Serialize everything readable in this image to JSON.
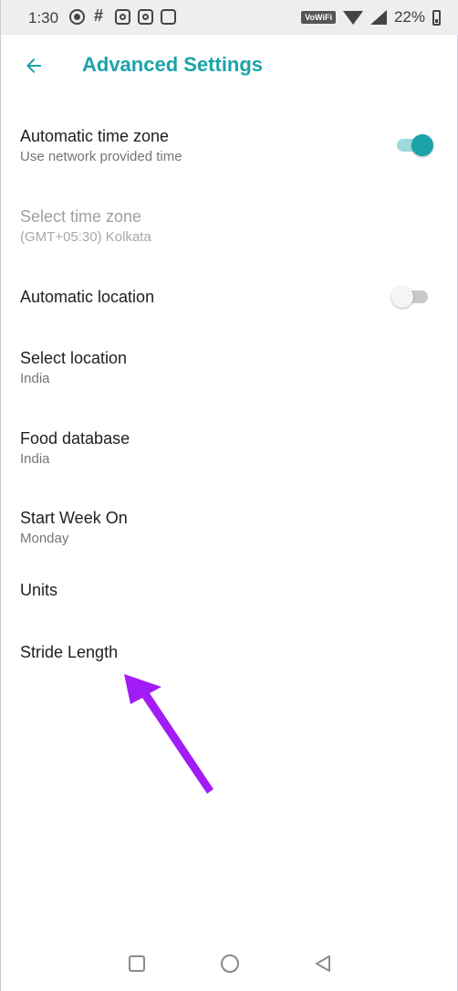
{
  "status_bar": {
    "time": "1:30",
    "network_label": "VoWiFi",
    "battery_percent": "22%",
    "icons": [
      "circle-notification-icon",
      "slack-icon",
      "instagram-icon",
      "instagram-icon",
      "app-icon"
    ]
  },
  "header": {
    "back_icon": "arrow-left-icon",
    "title": "Advanced Settings"
  },
  "settings": [
    {
      "title": "Automatic time zone",
      "subtitle": "Use network provided time",
      "toggle": true,
      "enabled": true
    },
    {
      "title": "Select time zone",
      "subtitle": "(GMT+05:30) Kolkata",
      "enabled": false
    },
    {
      "title": "Automatic location",
      "subtitle": "",
      "toggle": false,
      "enabled": true
    },
    {
      "title": "Select location",
      "subtitle": "India",
      "enabled": true
    },
    {
      "title": "Food database",
      "subtitle": "India",
      "enabled": true
    },
    {
      "title": "Start Week On",
      "subtitle": "Monday",
      "enabled": true
    },
    {
      "title": "Units",
      "subtitle": "",
      "enabled": true
    },
    {
      "title": "Stride Length",
      "subtitle": "",
      "enabled": true
    }
  ],
  "colors": {
    "accent": "#1aa3a8",
    "annotation_arrow": "#a21cf5"
  },
  "nav_bar": {
    "icons": [
      "recents-square-icon",
      "home-circle-icon",
      "back-triangle-icon"
    ]
  }
}
